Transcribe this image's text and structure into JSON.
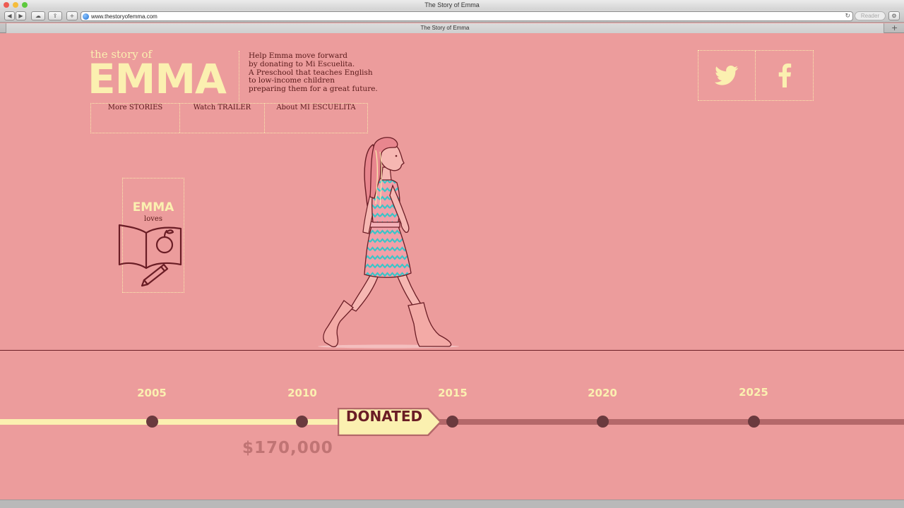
{
  "browser": {
    "window_title": "The Story of Emma",
    "url": "www.thestoryofemma.com",
    "reader_label": "Reader",
    "tab_title": "The Story of Emma"
  },
  "header": {
    "logo_small": "the story of",
    "logo_big": "EMMA",
    "tagline": "Help Emma move forward\nby donating to Mi Escuelita.\nA Preschool that teaches English\nto low-income children\npreparing them for a great future."
  },
  "nav": [
    {
      "label": "More STORIES"
    },
    {
      "label": "Watch TRAILER"
    },
    {
      "label": "About MI ESCUELITA"
    }
  ],
  "social": [
    {
      "icon": "twitter-icon"
    },
    {
      "icon": "facebook-icon"
    }
  ],
  "loves_card": {
    "title": "EMMA",
    "subtitle": "loves",
    "icon": "book-apple-pencil-icon"
  },
  "timeline": {
    "years": [
      "2005",
      "2010",
      "2015",
      "2020",
      "2025"
    ],
    "progress_label": "DONATED",
    "amount": "$170,000"
  },
  "colors": {
    "background": "#ec9c9c",
    "cream": "#fbf0b0",
    "maroon": "#6a1d25",
    "track_remaining": "#b4686a"
  }
}
